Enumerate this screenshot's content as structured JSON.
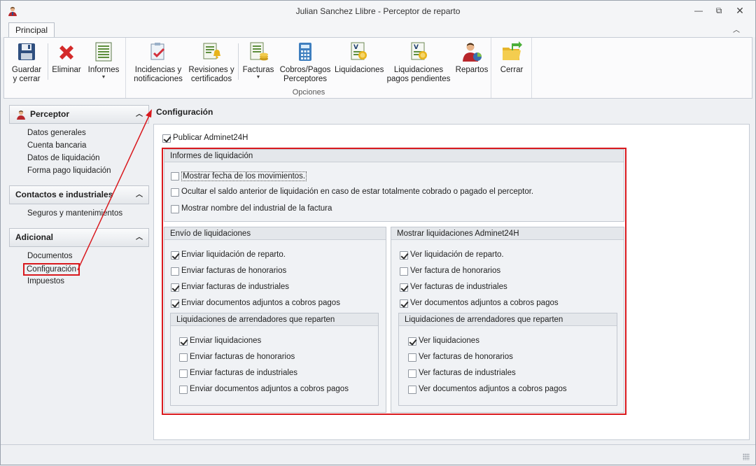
{
  "window": {
    "title": "Julian Sanchez Llibre - Perceptor de reparto"
  },
  "tabs": {
    "principal": "Principal"
  },
  "ribbon": {
    "guardar": [
      "Guardar",
      "y cerrar"
    ],
    "eliminar": "Eliminar",
    "informes": "Informes",
    "incidencias": [
      "Incidencias y",
      "notificaciones"
    ],
    "revisiones": [
      "Revisiones y",
      "certificados"
    ],
    "facturas": "Facturas",
    "cobros": [
      "Cobros/Pagos",
      "Perceptores"
    ],
    "liquidaciones": "Liquidaciones",
    "liq_pendientes": [
      "Liquidaciones",
      "pagos pendientes"
    ],
    "repartos": "Repartos",
    "cerrar": "Cerrar",
    "group_opciones": "Opciones"
  },
  "nav": {
    "perceptor": {
      "title": "Perceptor",
      "items": [
        "Datos generales",
        "Cuenta bancaria",
        "Datos de liquidación",
        "Forma pago liquidación"
      ]
    },
    "contactos": {
      "title": "Contactos e industriales",
      "items": [
        "Seguros y mantenimientos"
      ]
    },
    "adicional": {
      "title": "Adicional",
      "items": [
        "Documentos",
        "Configuración",
        "Impuestos"
      ]
    }
  },
  "main": {
    "title": "Configuración",
    "publicar": {
      "label": "Publicar Adminet24H",
      "checked": true
    },
    "informes": {
      "title": "Informes de liquidación",
      "items": [
        {
          "label": "Mostrar fecha de los movimientos.",
          "checked": false
        },
        {
          "label": "Ocultar el saldo anterior de liquidación en caso de estar totalmente cobrado o pagado el perceptor.",
          "checked": false
        },
        {
          "label": "Mostrar nombre del industrial de la factura",
          "checked": false
        }
      ]
    },
    "envio": {
      "title": "Envío de liquidaciones",
      "items": [
        {
          "label": "Enviar liquidación de reparto.",
          "checked": true
        },
        {
          "label": "Enviar facturas de honorarios",
          "checked": false
        },
        {
          "label": "Enviar facturas de industriales",
          "checked": true
        },
        {
          "label": "Enviar documentos adjuntos a cobros pagos",
          "checked": true
        }
      ],
      "sub": {
        "title": "Liquidaciones de arrendadores que reparten",
        "items": [
          {
            "label": "Enviar liquidaciones",
            "checked": true
          },
          {
            "label": "Enviar facturas de honorarios",
            "checked": false
          },
          {
            "label": "Enviar facturas de industriales",
            "checked": false
          },
          {
            "label": "Enviar documentos adjuntos a cobros pagos",
            "checked": false
          }
        ]
      }
    },
    "mostrar": {
      "title": "Mostrar liquidaciones Adminet24H",
      "items": [
        {
          "label": "Ver liquidación de reparto.",
          "checked": true
        },
        {
          "label": "Ver factura de honorarios",
          "checked": false
        },
        {
          "label": "Ver facturas de industriales",
          "checked": true
        },
        {
          "label": "Ver documentos adjuntos a cobros pagos",
          "checked": true
        }
      ],
      "sub": {
        "title": "Liquidaciones de arrendadores que reparten",
        "items": [
          {
            "label": "Ver liquidaciones",
            "checked": true
          },
          {
            "label": "Ver facturas de honorarios",
            "checked": false
          },
          {
            "label": "Ver facturas de industriales",
            "checked": false
          },
          {
            "label": "Ver documentos adjuntos a cobros pagos",
            "checked": false
          }
        ]
      }
    }
  },
  "colors": {
    "highlight": "#d9191e"
  }
}
